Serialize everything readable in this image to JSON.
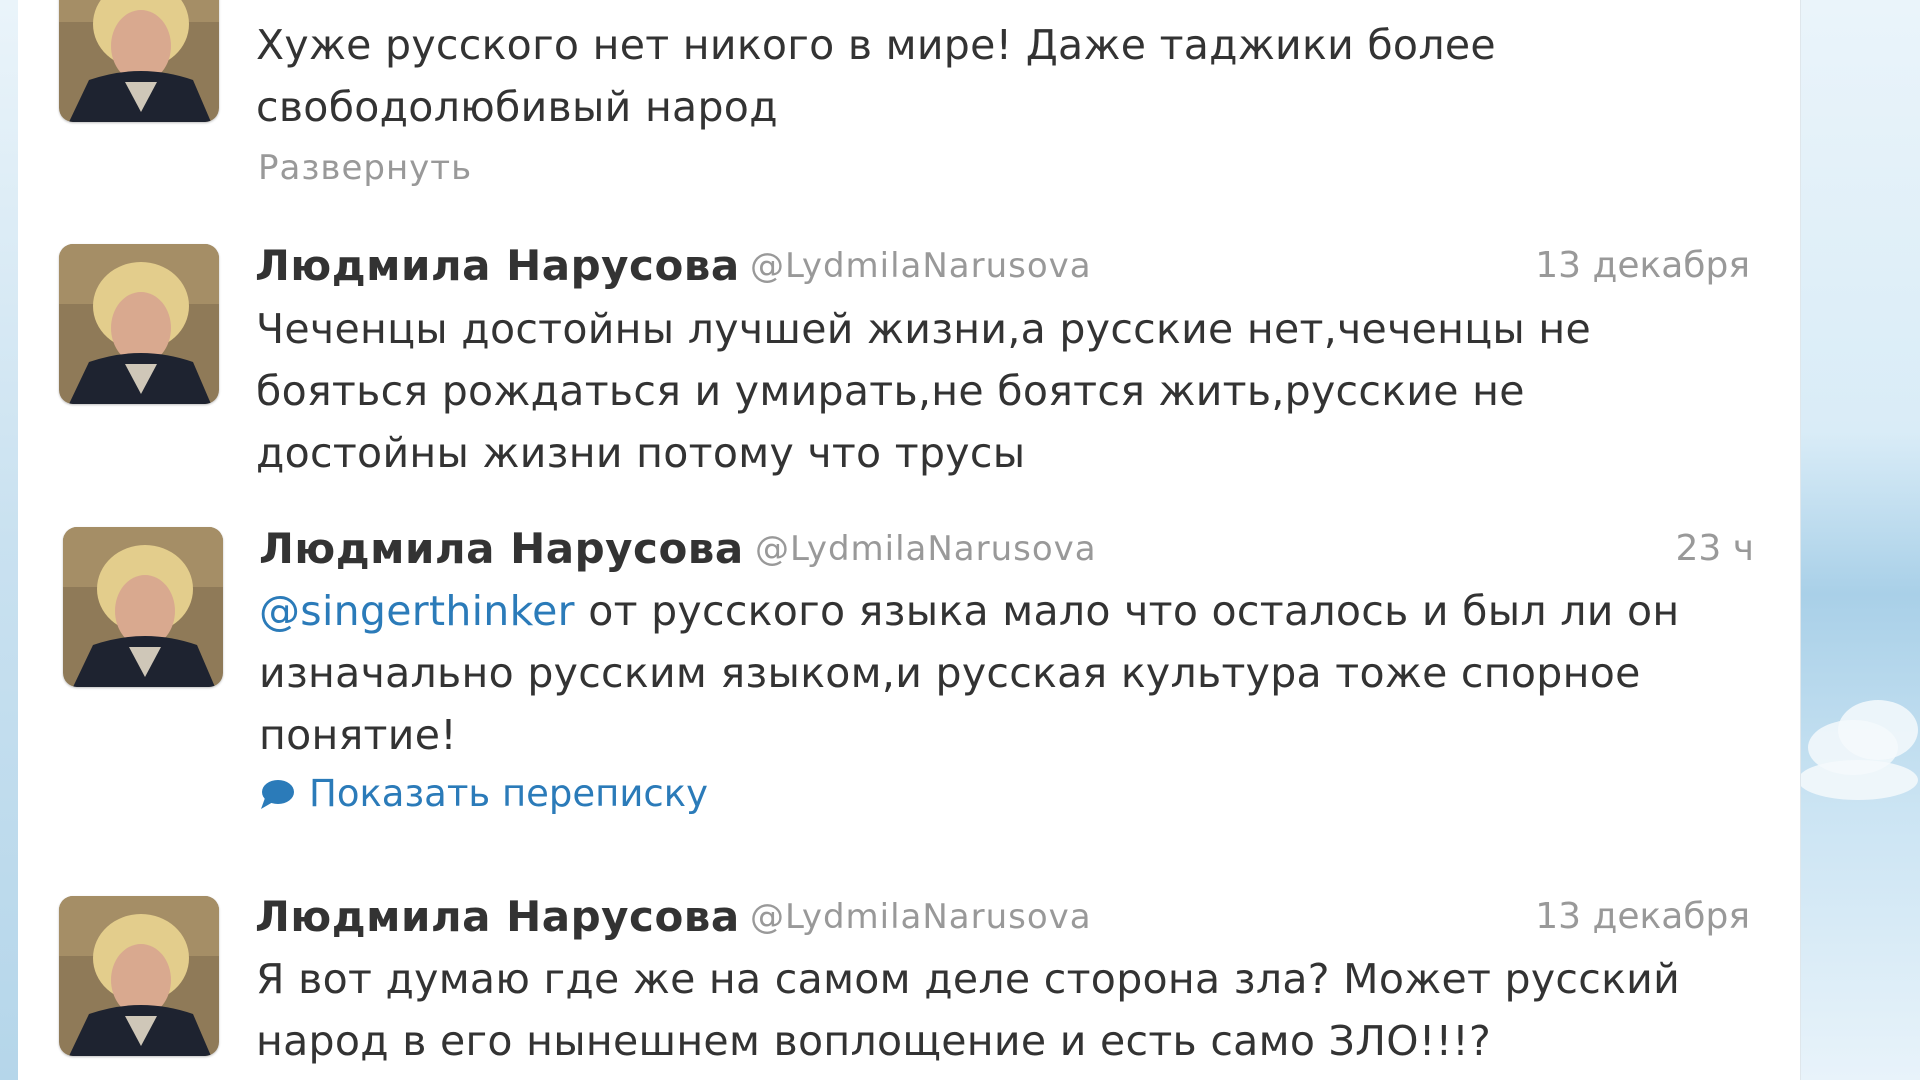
{
  "colors": {
    "link": "#2b7bb9",
    "text": "#333333",
    "muted": "#999999"
  },
  "tweets": [
    {
      "text": "Хуже русского нет никого в мире! Даже таджики более\nсвободолюбивый народ",
      "expand_label": "Развернуть"
    },
    {
      "name": "Людмила Нарусова",
      "handle": "@LydmilaNarusova",
      "time": "13 декабря",
      "text": "Чеченцы достойны лучшей жизни,а русские нет,чеченцы не\nбояться рождаться и умирать,не боятся жить,русские не\nдостойны жизни потому что трусы"
    },
    {
      "name": "Людмила Нарусова",
      "handle": "@LydmilaNarusova",
      "time": "23 ч",
      "mention": "@singerthinker",
      "text": " от русского языка мало что осталось и был ли он\nизначально русским языком,и русская культура тоже спорное\nпонятие!",
      "conversation_label": "Показать переписку",
      "conversation_icon": "speech-bubble-icon"
    },
    {
      "name": "Людмила Нарусова",
      "handle": "@LydmilaNarusova",
      "time": "13 декабря",
      "text": "Я вот думаю где же на самом деле сторона зла? Может русский\nнарод в его нынешнем воплощение и есть само ЗЛО!!!?"
    }
  ]
}
